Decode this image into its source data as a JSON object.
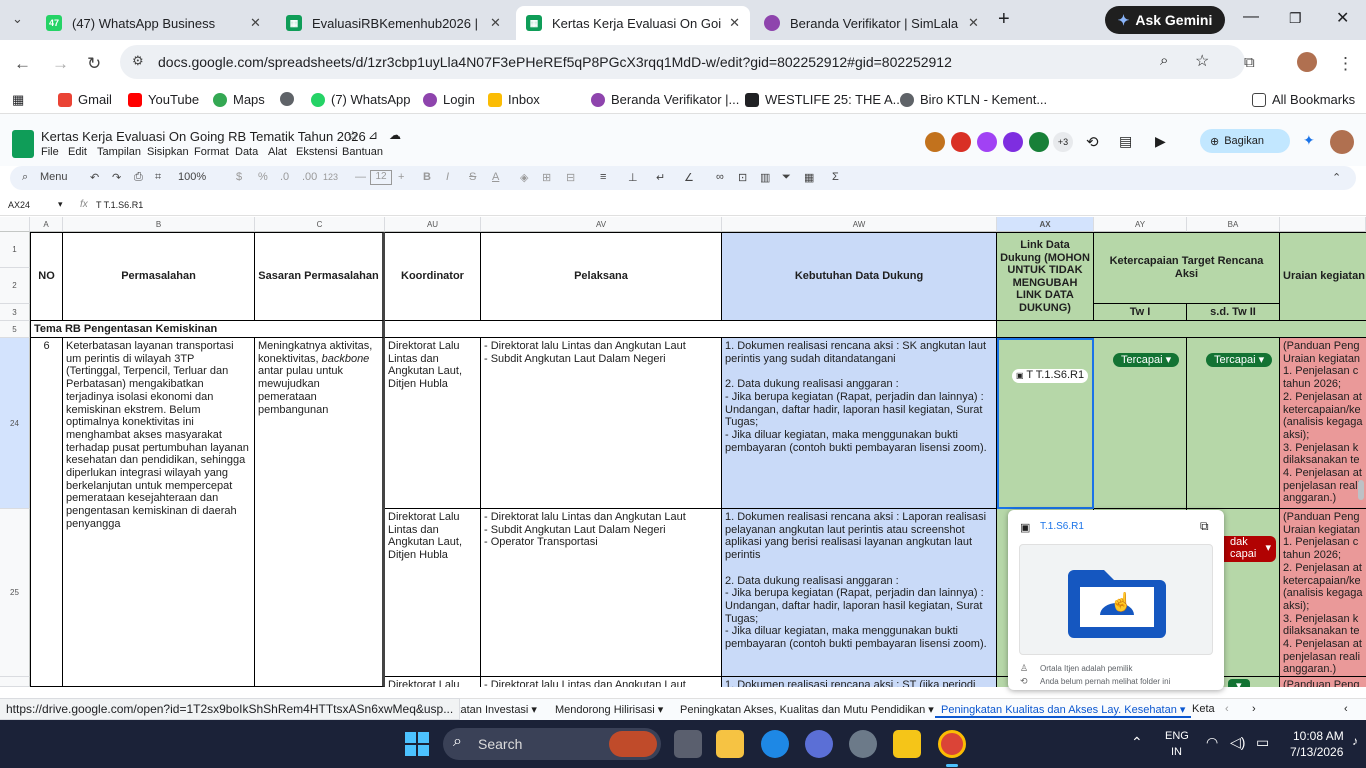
{
  "browser": {
    "tabs": [
      {
        "title": "(47) WhatsApp Business",
        "badge": "47",
        "color": "#25d366",
        "active": false
      },
      {
        "title": "EvaluasiRBKemenhub2026 | Link",
        "color": "#0f9d58",
        "active": false
      },
      {
        "title": "Kertas Kerja Evaluasi On Going",
        "color": "#0f9d58",
        "active": true
      },
      {
        "title": "Beranda Verifikator | SimLala",
        "color": "#8e44ad",
        "active": false
      }
    ],
    "gemini_label": "Ask Gemini",
    "url": "docs.google.com/spreadsheets/d/1zr3cbp1uyLla4N07F3ePHeREf5qP8PGcX3rqq1MdD-w/edit?gid=802252912#gid=802252912",
    "bookmarks": [
      "Gmail",
      "YouTube",
      "Maps",
      "",
      "(7) WhatsApp",
      "Login",
      "Inbox",
      "Beranda Verifikator |...",
      "WESTLIFE 25: THE A...",
      "Biro KTLN - Kement..."
    ],
    "all_bookmarks": "All Bookmarks"
  },
  "sheets": {
    "title": "Kertas Kerja Evaluasi On Going RB Tematik Tahun 2026",
    "menu": [
      "File",
      "Edit",
      "Tampilan",
      "Sisipkan",
      "Format",
      "Data",
      "Alat",
      "Ekstensi",
      "Bantuan"
    ],
    "share_label": "Bagikan",
    "collab_count": "+3",
    "toolbar": {
      "search": "Menu",
      "zoom": "100%",
      "font_size": "12",
      "currency": "$",
      "percent": "%",
      "dec_less": ".0",
      "dec_more": ".00",
      "numfmt": "123",
      "bold": "B",
      "italic": "I",
      "strike": "S",
      "textcolor": "A",
      "sigma": "Σ"
    },
    "name_box": "AX24",
    "fx": "fx",
    "formula": "T T.1.S6.R1"
  },
  "grid": {
    "col_letters": [
      "A",
      "B",
      "C",
      "AU",
      "AV",
      "AW",
      "AX",
      "AY",
      "BA"
    ],
    "row_numbers": [
      "1",
      "2",
      "3",
      "5",
      "24",
      "25"
    ],
    "headers": {
      "no": "NO",
      "permasalahan": "Permasalahan",
      "sasaran": "Sasaran Permasalahan",
      "koordinator": "Koordinator",
      "pelaksana": "Pelaksana",
      "kebutuhan": "Kebutuhan Data Dukung",
      "link": "Link Data Dukung (MOHON UNTUK TIDAK MENGUBAH LINK DATA DUKUNG)",
      "ketercapaian": "Ketercapaian Target Rencana Aksi",
      "tw1": "Tw I",
      "sdtw2": "s.d. Tw II",
      "uraian": "Uraian kegiatan"
    },
    "tema": "Tema RB Pengentasan Kemiskinan",
    "row24": {
      "no": "6",
      "permasalahan": "Keterbatasan layanan transportasi um perintis di wilayah 3TP (Tertinggal, Terpencil, Terluar dan Perbatasan) mengakibatkan terjadinya isolasi ekonomi dan kemiskinan ekstrem. Belum optimalnya konektivitas ini menghambat akses masyarakat terhadap pusat pertumbuhan layanan kesehatan dan pendidikan, sehingga diperlukan integrasi wilayah yang berkelanjutan untuk mempercepat pemerataan kesejahteraan dan pengentasan kemiskinan di daerah penyangga",
      "sasaran_1": "Meningkatnya aktivitas, konektivitas, ",
      "sasaran_italic": "backbone",
      "sasaran_2": " antar pulau untuk mewujudkan pemerataan pembangunan",
      "koordinator": "Direktorat Lalu Lintas dan Angkutan Laut, Ditjen Hubla",
      "pelaksana": "- Direktorat lalu Lintas dan Angkutan Laut\n- Subdit Angkutan Laut Dalam Negeri",
      "kebutuhan": "1. Dokumen realisasi rencana aksi : SK angkutan laut perintis yang sudah ditandatangani\n\n2. Data dukung realisasi anggaran :\n- Jika berupa kegiatan (Rapat, perjadin dan lainnya) : Undangan, daftar hadir, laporan hasil kegiatan, Surat Tugas;\n- Jika diluar kegiatan, maka menggunakan bukti pembayaran (contoh bukti pembayaran lisensi zoom).",
      "link": "T T.1.S6.R1",
      "tw1": "Tercapai",
      "sdtw2": "Tercapai",
      "uraian": "(Panduan Peng\nUraian kegiatan\n1. Penjelasan c\ntahun 2026;\n2. Penjelasan at\nketercapaian/ke\n(analisis kegaga\naksi);\n3. Penjelasan k\ndilaksanakan te\n4. Penjelasan at\npenjelasan reali\nanggaran.)"
    },
    "row25": {
      "koordinator": "Direktorat Lalu Lintas dan Angkutan Laut, Ditjen Hubla",
      "pelaksana": "- Direktorat lalu Lintas dan Angkutan Laut\n- Subdit Angkutan Laut Dalam Negeri\n- Operator Transportasi",
      "kebutuhan": "1. Dokumen realisasi rencana aksi : Laporan realisasi pelayanan angkutan laut perintis atau screenshot aplikasi yang berisi realisasi layanan angkutan laut perintis\n\n2. Data dukung realisasi anggaran :\n- Jika berupa kegiatan (Rapat, perjadin dan lainnya) : Undangan, daftar hadir, laporan hasil kegiatan, Surat Tugas;\n- Jika diluar kegiatan, maka menggunakan bukti pembayaran (contoh bukti pembayaran lisensi zoom).",
      "sdtw2": "dak\ncapai",
      "uraian": "(Panduan Peng\nUraian kegiatan\n1. Penjelasan c\ntahun 2026;\n2. Penjelasan at\nketercapaian/ke\n(analisis kegaga\naksi);\n3. Penjelasan k\ndilaksanakan te\n4. Penjelasan at\npenjelasan reali\nanggaran.)"
    },
    "row26": {
      "koordinator": "Direktorat Lalu",
      "pelaksana": "- Direktorat lalu Lintas dan Angkutan Laut",
      "kebutuhan": "1. Dokumen realisasi rencana aksi : ST (jika periodi",
      "uraian": "(Panduan Peng"
    }
  },
  "card": {
    "title": "T.1.S6.R1",
    "owner": "Ortala Itjen adalah pemilik",
    "note": "Anda belum pernah melihat folder ini"
  },
  "status_url": "https://drive.google.com/open?id=1T2sx9boIkShShRem4HTTtsxASn6xwMeq&usp...",
  "sheet_tabs": [
    "katan Investasi",
    "Mendorong Hilirisasi",
    "Peningkatan Akses, Kualitas dan Mutu Pendidikan",
    "Peningkatan Kualitas dan Akses Lay. Kesehatan",
    "Keta"
  ],
  "taskbar": {
    "search": "Search",
    "lang1": "ENG",
    "lang2": "IN",
    "time": "10:08 AM",
    "date": "7/13/2026"
  },
  "colors": {
    "blue_col": "#c9daf8",
    "green_col": "#b6d7a8",
    "red_col": "#ea9999",
    "chip_green": "#137333",
    "chip_red": "#b10202",
    "selected": "#1a73e8"
  }
}
